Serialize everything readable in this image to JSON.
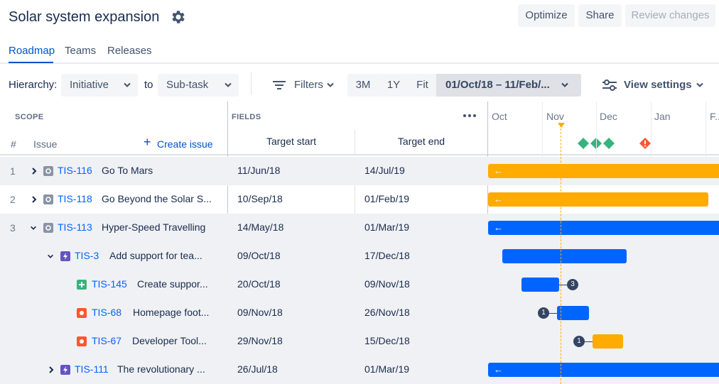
{
  "header": {
    "title": "Solar system expansion",
    "buttons": {
      "optimize": "Optimize",
      "share": "Share",
      "review": "Review changes"
    }
  },
  "tabs": [
    {
      "label": "Roadmap",
      "active": true
    },
    {
      "label": "Teams",
      "active": false
    },
    {
      "label": "Releases",
      "active": false
    }
  ],
  "toolbar": {
    "hierarchy_label": "Hierarchy:",
    "hierarchy_from": "Initiative",
    "to_label": "to",
    "hierarchy_to": "Sub-task",
    "filters": "Filters",
    "zoom": [
      "3M",
      "1Y",
      "Fit"
    ],
    "date_range": "01/Oct/18 – 11/Feb/...",
    "view_settings": "View settings"
  },
  "columns": {
    "scope": "SCOPE",
    "fields": "FIELDS",
    "num": "#",
    "issue": "Issue",
    "create_issue": "Create issue",
    "target_start": "Target start",
    "target_end": "Target end",
    "months": [
      "Oct",
      "Nov",
      "Dec",
      "Jan",
      "F..."
    ]
  },
  "rows": [
    {
      "num": "1",
      "caret": "right",
      "type": "initiative",
      "key": "TIS-116",
      "summary": "Go To Mars",
      "start": "11/Jun/18",
      "end": "14/Jul/19"
    },
    {
      "num": "2",
      "caret": "right",
      "type": "initiative",
      "key": "TIS-118",
      "summary": "Go Beyond the Solar S...",
      "start": "10/Sep/18",
      "end": "01/Feb/19"
    },
    {
      "num": "3",
      "caret": "down",
      "type": "initiative",
      "key": "TIS-113",
      "summary": "Hyper-Speed Travelling",
      "start": "14/May/18",
      "end": "01/Mar/19"
    },
    {
      "num": "",
      "caret": "down",
      "type": "epic",
      "key": "TIS-3",
      "summary": "Add support for tea...",
      "start": "09/Oct/18",
      "end": "17/Dec/18"
    },
    {
      "num": "",
      "caret": "",
      "type": "story",
      "key": "TIS-145",
      "summary": "Create suppor...",
      "start": "20/Oct/18",
      "end": "09/Nov/18",
      "dep_after": "3"
    },
    {
      "num": "",
      "caret": "",
      "type": "bug",
      "key": "TIS-68",
      "summary": "Homepage foot...",
      "start": "09/Nov/18",
      "end": "26/Nov/18",
      "dep_before": "1"
    },
    {
      "num": "",
      "caret": "",
      "type": "bug",
      "key": "TIS-67",
      "summary": "Developer Tool...",
      "start": "29/Nov/18",
      "end": "15/Dec/18",
      "dep_before": "1"
    },
    {
      "num": "",
      "caret": "right",
      "type": "epic",
      "key": "TIS-111",
      "summary": "The revolutionary ...",
      "start": "26/Jul/18",
      "end": "01/Mar/19"
    }
  ],
  "colors": {
    "accent": "#0052CC",
    "link": "#0065FF",
    "initiative_bar": "#FFAB00",
    "epic_bar": "#0065FF",
    "milestone": "#36B37E",
    "warning": "#FF5630",
    "today_line": "#FFAB00"
  }
}
